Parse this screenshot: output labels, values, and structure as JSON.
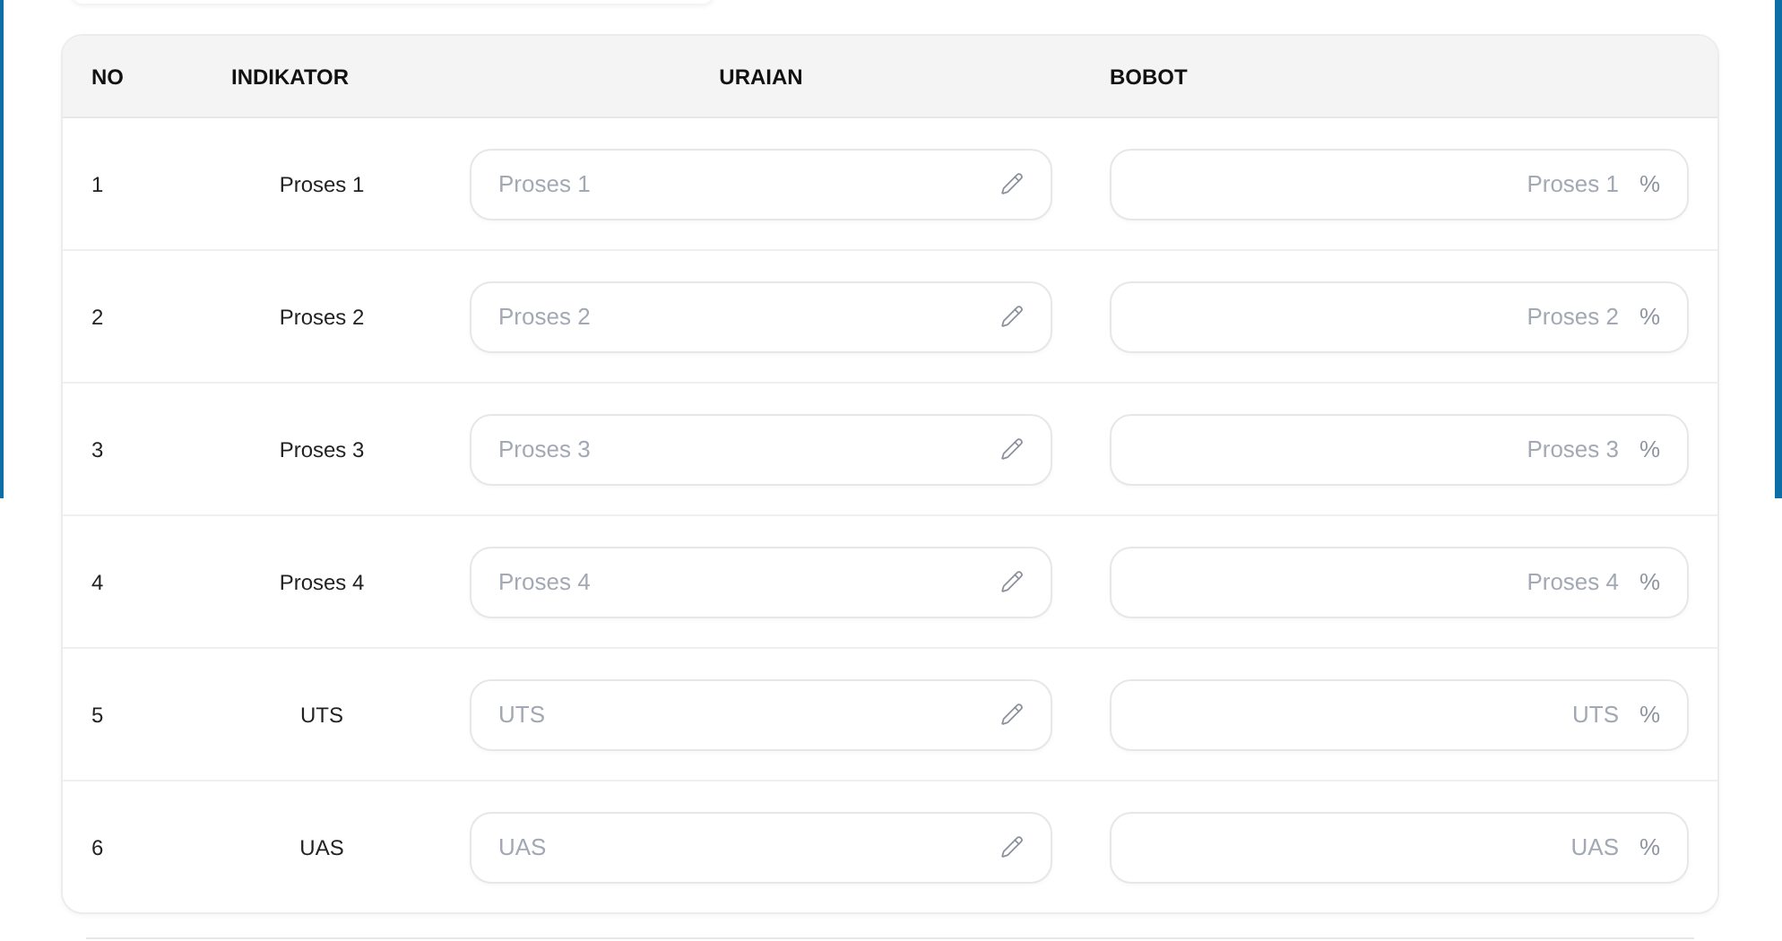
{
  "table": {
    "columns": [
      "NO",
      "INDIKATOR",
      "URAIAN",
      "BOBOT"
    ],
    "rows": [
      {
        "no": "1",
        "indikator": "Proses 1",
        "uraian_placeholder": "Proses 1",
        "bobot_placeholder": "Proses 1",
        "bobot_suffix": "%"
      },
      {
        "no": "2",
        "indikator": "Proses 2",
        "uraian_placeholder": "Proses 2",
        "bobot_placeholder": "Proses 2",
        "bobot_suffix": "%"
      },
      {
        "no": "3",
        "indikator": "Proses 3",
        "uraian_placeholder": "Proses 3",
        "bobot_placeholder": "Proses 3",
        "bobot_suffix": "%"
      },
      {
        "no": "4",
        "indikator": "Proses 4",
        "uraian_placeholder": "Proses 4",
        "bobot_placeholder": "Proses 4",
        "bobot_suffix": "%"
      },
      {
        "no": "5",
        "indikator": "UTS",
        "uraian_placeholder": "UTS",
        "bobot_placeholder": "UTS",
        "bobot_suffix": "%"
      },
      {
        "no": "6",
        "indikator": "UAS",
        "uraian_placeholder": "UAS",
        "bobot_placeholder": "UAS",
        "bobot_suffix": "%"
      }
    ]
  }
}
